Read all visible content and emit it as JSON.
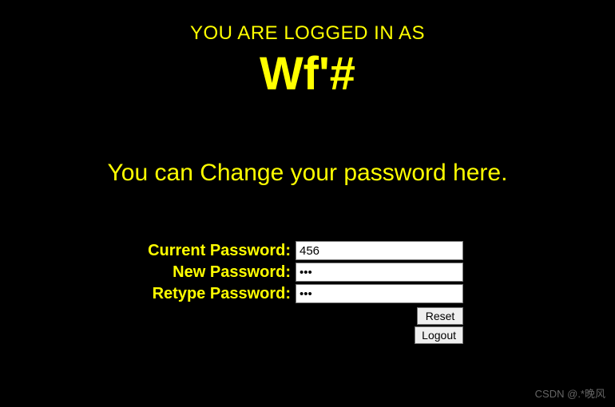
{
  "header": {
    "logged_in_text": "YOU ARE LOGGED IN AS",
    "username": "Wf'#"
  },
  "subtitle": "You can Change your password here.",
  "form": {
    "current_password": {
      "label": "Current Password:",
      "value": "456"
    },
    "new_password": {
      "label": "New Password:",
      "value": "•••"
    },
    "retype_password": {
      "label": "Retype Password:",
      "value": "•••"
    },
    "reset_label": "Reset",
    "logout_label": "Logout"
  },
  "watermark": "CSDN @.*晚风"
}
